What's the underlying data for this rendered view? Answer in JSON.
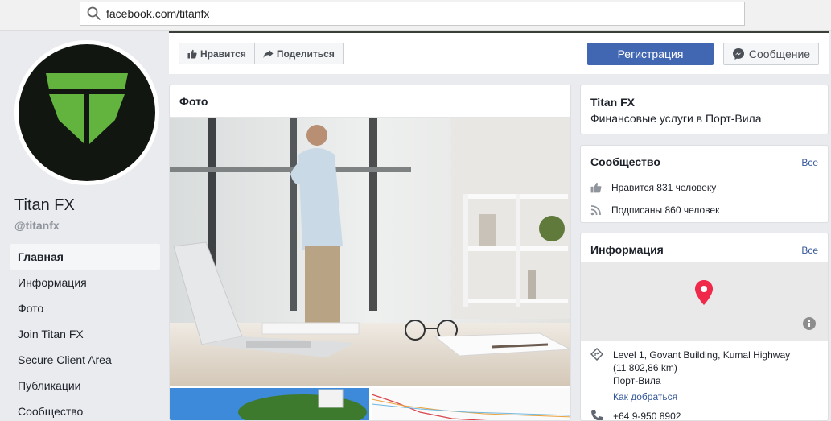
{
  "browser": {
    "url": "facebook.com/titanfx"
  },
  "page": {
    "name": "Titan FX",
    "handle": "@titanfx"
  },
  "nav": {
    "items": [
      "Главная",
      "Информация",
      "Фото",
      "Join Titan FX",
      "Secure Client Area",
      "Публикации",
      "Сообщество"
    ]
  },
  "actions": {
    "like": "Нравится",
    "share": "Поделиться",
    "register": "Регистрация",
    "message": "Сообщение"
  },
  "photos": {
    "title": "Фото"
  },
  "about": {
    "title": "Titan FX",
    "category": "Финансовые услуги в Порт-Вила"
  },
  "community": {
    "title": "Сообщество",
    "all": "Все",
    "likes": "Нравится 831 человеку",
    "follows": "Подписаны 860 человек"
  },
  "info": {
    "title": "Информация",
    "all": "Все",
    "address_line1": "Level 1, Govant Building, Kumal Highway",
    "distance": "(11 802,86 km)",
    "city": "Порт-Вила",
    "directions": "Как добраться",
    "phone": "+64 9-950 8902"
  },
  "colors": {
    "brand_blue": "#4267b2",
    "link": "#365899",
    "logo_green": "#62b43f",
    "map_pin": "#f02849"
  }
}
